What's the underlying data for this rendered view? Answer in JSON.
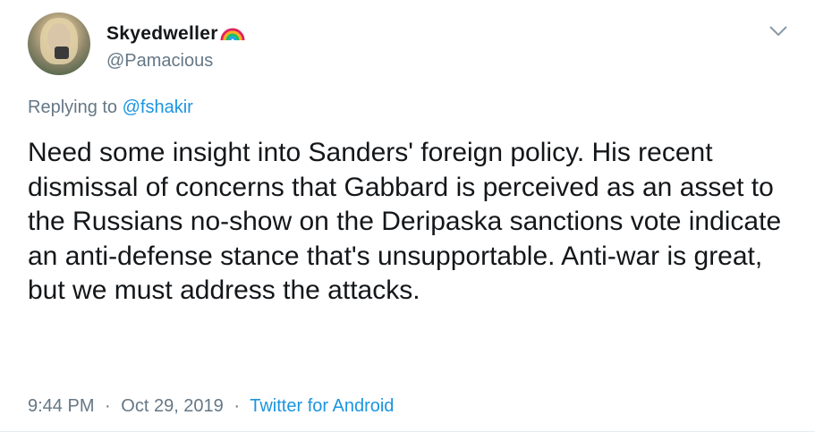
{
  "tweet": {
    "display_name": "Skyedweller",
    "display_name_emoji": "rainbow-emoji",
    "handle": "@Pamacious",
    "replying_prefix": "Replying to",
    "replying_mention": "@fshakir",
    "text": "Need some insight into Sanders' foreign policy. His recent dismissal of concerns that Gabbard is perceived as an asset to the Russians no-show on the Deripaska sanctions vote indicate an anti-defense stance that's unsupportable. Anti-war is great, but we must address the attacks.",
    "time": "9:44 PM",
    "separator": "·",
    "date": "Oct 29, 2019",
    "source": "Twitter for Android",
    "menu_icon": "chevron-down-icon"
  },
  "colors": {
    "text": "#14171a",
    "secondary": "#657786",
    "link": "#1b95e0"
  }
}
